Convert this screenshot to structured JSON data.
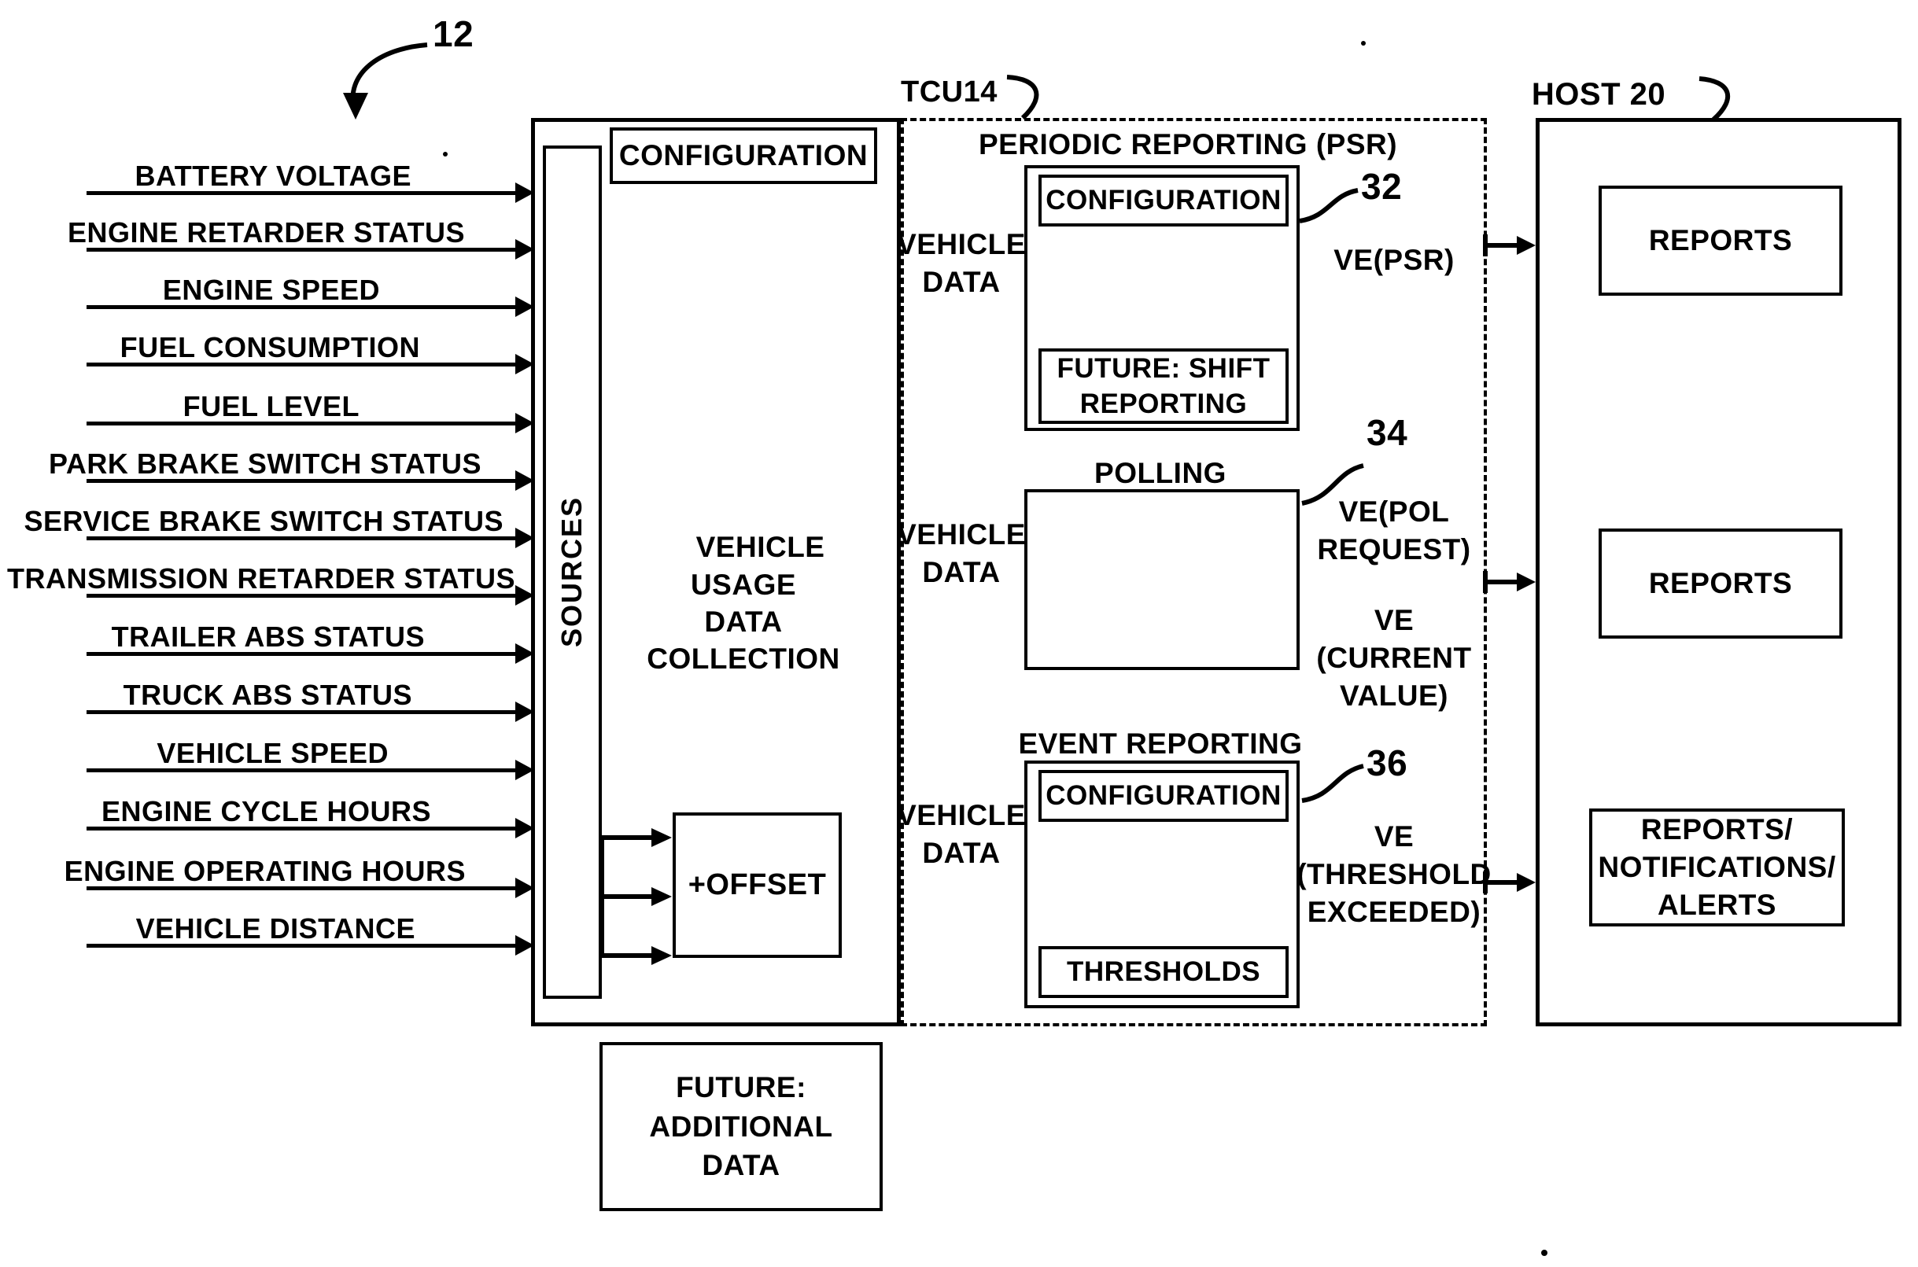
{
  "figure": {
    "ref_main": "12",
    "tcu_label": "TCU14",
    "host_label": "HOST 20"
  },
  "inputs": {
    "signals": [
      "BATTERY VOLTAGE",
      "ENGINE RETARDER STATUS",
      "ENGINE SPEED",
      "FUEL CONSUMPTION",
      "FUEL LEVEL",
      "PARK BRAKE SWITCH STATUS",
      "SERVICE BRAKE SWITCH STATUS",
      "TRANSMISSION RETARDER STATUS",
      "TRAILER ABS STATUS",
      "TRUCK ABS STATUS",
      "VEHICLE SPEED",
      "ENGINE CYCLE HOURS",
      "ENGINE OPERATING HOURS",
      "VEHICLE DISTANCE"
    ]
  },
  "tcu": {
    "sources_label": "SOURCES",
    "configuration_label": "CONFIGURATION",
    "collection_label": "VEHICLE\nUSAGE\nDATA\nCOLLECTION",
    "offset_label": "+OFFSET",
    "future_additional_label": "FUTURE:\nADDITIONAL\nDATA"
  },
  "reporting": {
    "psr": {
      "title": "PERIODIC REPORTING (PSR)",
      "vehicle_data_label": "VEHICLE\nDATA",
      "configuration_label": "CONFIGURATION",
      "future_label": "FUTURE: SHIFT\nREPORTING",
      "ref": "32",
      "ve_label": "VE(PSR)"
    },
    "polling": {
      "title": "POLLING",
      "vehicle_data_label": "VEHICLE\nDATA",
      "ref": "34",
      "ve_request_label": "VE(POL\nREQUEST)",
      "ve_current_label": "VE\n(CURRENT\nVALUE)"
    },
    "event": {
      "title": "EVENT REPORTING",
      "vehicle_data_label": "VEHICLE\nDATA",
      "configuration_label": "CONFIGURATION",
      "thresholds_label": "THRESHOLDS",
      "ref": "36",
      "ve_label": "VE\n(THRESHOLD\nEXCEEDED)"
    }
  },
  "host": {
    "outputs": [
      "REPORTS",
      "REPORTS",
      "REPORTS/\nNOTIFICATIONS/\nALERTS"
    ]
  },
  "colors": {
    "ink": "#000000",
    "paper": "#ffffff"
  }
}
